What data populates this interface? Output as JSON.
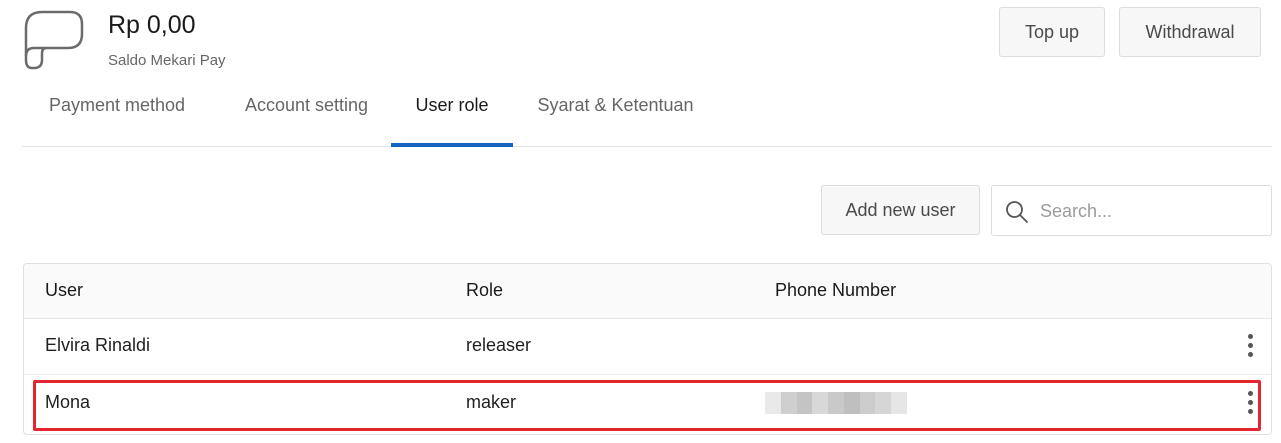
{
  "header": {
    "balance_amount": "Rp 0,00",
    "balance_label": "Saldo Mekari Pay",
    "topup_label": "Top up",
    "withdraw_label": "Withdrawal"
  },
  "tabs": [
    {
      "label": "Payment method",
      "active": false
    },
    {
      "label": "Account setting",
      "active": false
    },
    {
      "label": "User role",
      "active": true
    },
    {
      "label": "Syarat & Ketentuan",
      "active": false
    }
  ],
  "toolbar": {
    "add_user_label": "Add new user",
    "search_placeholder": "Search...",
    "search_value": ""
  },
  "table": {
    "columns": [
      "User",
      "Role",
      "Phone Number"
    ],
    "rows": [
      {
        "user": "Elvira Rinaldi",
        "role": "releaser",
        "phone": ""
      },
      {
        "user": "Mona",
        "role": "maker",
        "phone": ""
      }
    ]
  },
  "colors": {
    "accent": "#1565c0",
    "highlight": "#e3262f"
  }
}
